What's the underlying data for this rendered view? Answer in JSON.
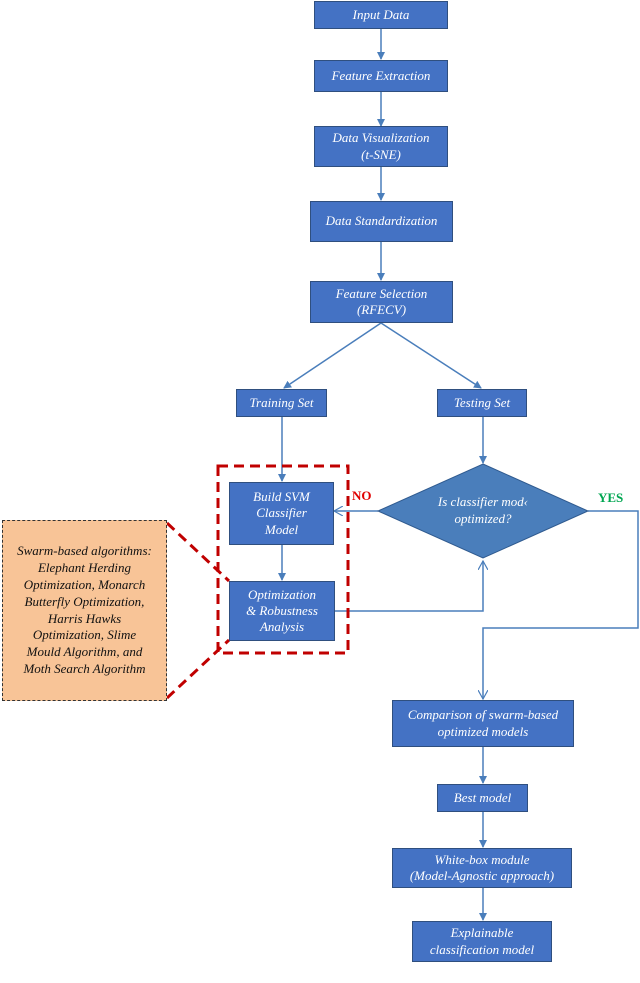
{
  "diagram": {
    "nodes": {
      "input_data": "Input Data",
      "feature_extraction": "Feature Extraction",
      "data_visualization": "Data Visualization\n(t-SNE)",
      "data_standardization": "Data Standardization",
      "feature_selection": "Feature Selection\n(RFECV)",
      "training_set": "Training Set",
      "testing_set": "Testing Set",
      "build_svm": "Build SVM\nClassifier\nModel",
      "optimization": "Optimization\n& Robustness\nAnalysis",
      "decision": "Is classifier mod‹\noptimized?",
      "comparison": "Comparison of swarm-based\noptimized models",
      "best_model": "Best model",
      "white_box": "White-box module\n(Model-Agnostic approach)",
      "explainable": "Explainable\nclassification model"
    },
    "note": "Swarm-based algorithms:\nElephant Herding\nOptimization, Monarch\nButterfly Optimization,\nHarris Hawks\nOptimization, Slime\nMould Algorithm, and\nMoth Search Algorithm",
    "labels": {
      "no": "NO",
      "yes": "YES"
    },
    "colors": {
      "box_fill": "#4472c4",
      "connector": "#4a7ebb",
      "dashed_group": "#c00000",
      "note_fill": "#f8c497",
      "no_label": "#e00000",
      "yes_label": "#00a651"
    }
  }
}
